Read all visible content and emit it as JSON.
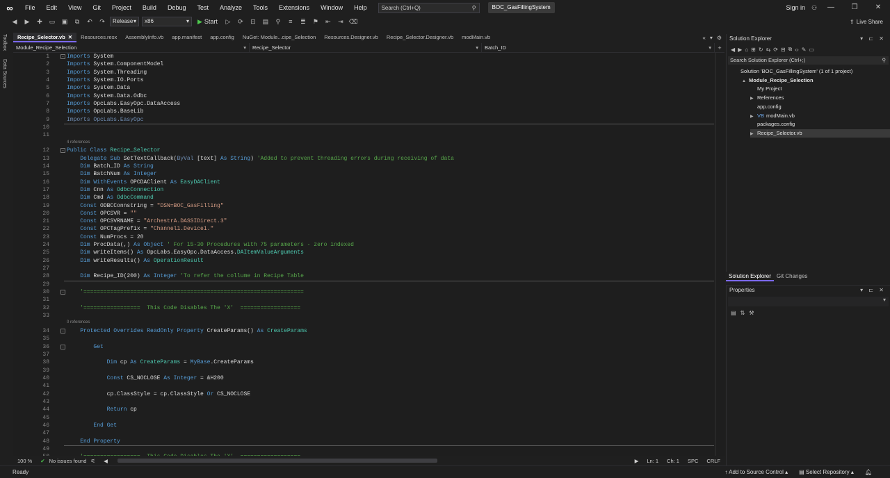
{
  "menubar": {
    "items": [
      "File",
      "Edit",
      "View",
      "Git",
      "Project",
      "Build",
      "Debug",
      "Test",
      "Analyze",
      "Tools",
      "Extensions",
      "Window",
      "Help"
    ],
    "search_placeholder": "Search (Ctrl+Q)",
    "solution_title": "BOC_GasFillingSystem",
    "signin": "Sign in",
    "window_controls": [
      "—",
      "❐",
      "✕"
    ]
  },
  "toolbar": {
    "config": "Release",
    "platform": "x86",
    "start_label": "Start",
    "live_share": "Live Share"
  },
  "left_rail": [
    "Toolbox",
    "Data Sources"
  ],
  "tabs": [
    {
      "label": "Recipe_Selector.vb",
      "active": true
    },
    {
      "label": "Resources.resx"
    },
    {
      "label": "AssemblyInfo.vb"
    },
    {
      "label": "app.manifest"
    },
    {
      "label": "app.config"
    },
    {
      "label": "NuGet: Module...cipe_Selection"
    },
    {
      "label": "Resources.Designer.vb"
    },
    {
      "label": "Recipe_Selector.Designer.vb"
    },
    {
      "label": "modMain.vb"
    }
  ],
  "navbar": {
    "project": "Module_Recipe_Selection",
    "class": "Recipe_Selector",
    "member": "Batch_ID"
  },
  "code": [
    {
      "n": "1",
      "t": [
        [
          "kw",
          "Imports"
        ],
        [
          "id",
          " System"
        ]
      ],
      "fold": "-"
    },
    {
      "n": "2",
      "t": [
        [
          "kw",
          "Imports"
        ],
        [
          "id",
          " System.ComponentModel"
        ]
      ]
    },
    {
      "n": "3",
      "t": [
        [
          "kw",
          "Imports"
        ],
        [
          "id",
          " System.Threading"
        ]
      ]
    },
    {
      "n": "4",
      "t": [
        [
          "kw",
          "Imports"
        ],
        [
          "id",
          " System.IO.Ports"
        ]
      ]
    },
    {
      "n": "5",
      "t": [
        [
          "kw",
          "Imports"
        ],
        [
          "id",
          " System.Data"
        ]
      ]
    },
    {
      "n": "6",
      "t": [
        [
          "kw",
          "Imports"
        ],
        [
          "id",
          " System.Data.Odbc"
        ]
      ]
    },
    {
      "n": "7",
      "t": [
        [
          "kw",
          "Imports"
        ],
        [
          "id",
          " OpcLabs.EasyOpc.DataAccess"
        ]
      ]
    },
    {
      "n": "8",
      "t": [
        [
          "kw",
          "Imports"
        ],
        [
          "id",
          " OpcLabs.BaseLib"
        ]
      ]
    },
    {
      "n": "9",
      "t": [
        [
          "fade",
          "Imports OpcLabs.EasyOpc"
        ]
      ]
    },
    {
      "n": "10",
      "t": []
    },
    {
      "n": "11",
      "t": []
    },
    {
      "n": "12",
      "t": [
        [
          "kw",
          "Public Class "
        ],
        [
          "ty",
          "Recipe_Selector"
        ]
      ],
      "fold": "-",
      "refs": "4 references"
    },
    {
      "n": "13",
      "t": [
        [
          "id",
          "    "
        ],
        [
          "kw",
          "Delegate Sub "
        ],
        [
          "id",
          "SetTextCallback("
        ],
        [
          "fade",
          "ByVal"
        ],
        [
          "id",
          " [text] "
        ],
        [
          "kw",
          "As String"
        ],
        [
          "id",
          ") "
        ],
        [
          "cm",
          "'Added to prevent threading errors during receiving of data"
        ]
      ]
    },
    {
      "n": "14",
      "t": [
        [
          "id",
          "    "
        ],
        [
          "kw",
          "Dim "
        ],
        [
          "id",
          "Batch_ID "
        ],
        [
          "kw",
          "As String"
        ]
      ]
    },
    {
      "n": "15",
      "t": [
        [
          "id",
          "    "
        ],
        [
          "kw",
          "Dim "
        ],
        [
          "id",
          "BatchNum "
        ],
        [
          "kw",
          "As Integer"
        ]
      ]
    },
    {
      "n": "16",
      "t": [
        [
          "id",
          "    "
        ],
        [
          "kw",
          "Dim WithEvents "
        ],
        [
          "id",
          "OPCDAClient "
        ],
        [
          "kw",
          "As "
        ],
        [
          "ty",
          "EasyDAClient"
        ]
      ]
    },
    {
      "n": "17",
      "t": [
        [
          "id",
          "    "
        ],
        [
          "kw",
          "Dim "
        ],
        [
          "id",
          "Cnn "
        ],
        [
          "kw",
          "As "
        ],
        [
          "ty",
          "OdbcConnection"
        ]
      ]
    },
    {
      "n": "18",
      "t": [
        [
          "id",
          "    "
        ],
        [
          "kw",
          "Dim "
        ],
        [
          "id",
          "Cmd "
        ],
        [
          "kw",
          "As "
        ],
        [
          "ty",
          "OdbcCommand"
        ]
      ]
    },
    {
      "n": "19",
      "t": [
        [
          "id",
          "    "
        ],
        [
          "kw",
          "Const "
        ],
        [
          "id",
          "ODBCConnstring = "
        ],
        [
          "st",
          "\"DSN=BOC_GasFilling\""
        ]
      ]
    },
    {
      "n": "20",
      "t": [
        [
          "id",
          "    "
        ],
        [
          "kw",
          "Const "
        ],
        [
          "id",
          "OPCSVR = "
        ],
        [
          "st",
          "\"\""
        ]
      ]
    },
    {
      "n": "21",
      "t": [
        [
          "id",
          "    "
        ],
        [
          "kw",
          "Const "
        ],
        [
          "id",
          "OPCSVRNAME = "
        ],
        [
          "st",
          "\"ArchestrA.DASSIDirect.3\""
        ]
      ]
    },
    {
      "n": "22",
      "t": [
        [
          "id",
          "    "
        ],
        [
          "kw",
          "Const "
        ],
        [
          "id",
          "OPCTagPrefix = "
        ],
        [
          "st",
          "\"Channel1.Device1.\""
        ]
      ]
    },
    {
      "n": "23",
      "t": [
        [
          "id",
          "    "
        ],
        [
          "kw",
          "Const "
        ],
        [
          "id",
          "NumProcs = 20"
        ]
      ]
    },
    {
      "n": "24",
      "t": [
        [
          "id",
          "    "
        ],
        [
          "kw",
          "Dim "
        ],
        [
          "id",
          "ProcData(,) "
        ],
        [
          "kw",
          "As Object "
        ],
        [
          "cm",
          "' For 15-30 Procedures with 75 parameters - zero indexed"
        ]
      ]
    },
    {
      "n": "25",
      "t": [
        [
          "id",
          "    "
        ],
        [
          "kw",
          "Dim "
        ],
        [
          "id",
          "writeItems() "
        ],
        [
          "kw",
          "As "
        ],
        [
          "id",
          "OpcLabs.EasyOpc.DataAccess."
        ],
        [
          "ty",
          "DAItemValueArguments"
        ]
      ]
    },
    {
      "n": "26",
      "t": [
        [
          "id",
          "    "
        ],
        [
          "kw",
          "Dim "
        ],
        [
          "id",
          "writeResults() "
        ],
        [
          "kw",
          "As "
        ],
        [
          "ty",
          "OperationResult"
        ]
      ]
    },
    {
      "n": "27",
      "t": []
    },
    {
      "n": "28",
      "t": [
        [
          "id",
          "    "
        ],
        [
          "kw",
          "Dim "
        ],
        [
          "id",
          "Recipe_ID(200) "
        ],
        [
          "kw",
          "As Integer "
        ],
        [
          "cm",
          "'To refer the collume in Recipe Table"
        ]
      ]
    },
    {
      "n": "29",
      "t": []
    },
    {
      "n": "30",
      "t": [
        [
          "id",
          "    "
        ],
        [
          "cm",
          "'=================================================================="
        ]
      ],
      "fold": "-"
    },
    {
      "n": "31",
      "t": []
    },
    {
      "n": "32",
      "t": [
        [
          "id",
          "    "
        ],
        [
          "cm",
          "'=================  This Code Disables The 'X'  =================="
        ]
      ]
    },
    {
      "n": "33",
      "t": []
    },
    {
      "n": "34",
      "t": [
        [
          "id",
          "    "
        ],
        [
          "kw",
          "Protected Overrides ReadOnly Property "
        ],
        [
          "id",
          "CreateParams() "
        ],
        [
          "kw",
          "As "
        ],
        [
          "ty",
          "CreateParams"
        ]
      ],
      "fold": "-",
      "refs": "0 references"
    },
    {
      "n": "35",
      "t": []
    },
    {
      "n": "36",
      "t": [
        [
          "id",
          "        "
        ],
        [
          "kw",
          "Get"
        ]
      ],
      "fold": "-"
    },
    {
      "n": "37",
      "t": []
    },
    {
      "n": "38",
      "t": [
        [
          "id",
          "            "
        ],
        [
          "kw",
          "Dim "
        ],
        [
          "id",
          "cp "
        ],
        [
          "kw",
          "As "
        ],
        [
          "ty",
          "CreateParams"
        ],
        [
          "id",
          " = "
        ],
        [
          "kw",
          "MyBase"
        ],
        [
          "id",
          ".CreateParams"
        ]
      ]
    },
    {
      "n": "39",
      "t": []
    },
    {
      "n": "40",
      "t": [
        [
          "id",
          "            "
        ],
        [
          "kw",
          "Const "
        ],
        [
          "id",
          "CS_NOCLOSE "
        ],
        [
          "kw",
          "As Integer"
        ],
        [
          "id",
          " = &H200"
        ]
      ]
    },
    {
      "n": "41",
      "t": []
    },
    {
      "n": "42",
      "t": [
        [
          "id",
          "            cp.ClassStyle = cp.ClassStyle "
        ],
        [
          "kw",
          "Or "
        ],
        [
          "id",
          "CS_NOCLOSE"
        ]
      ]
    },
    {
      "n": "43",
      "t": []
    },
    {
      "n": "44",
      "t": [
        [
          "id",
          "            "
        ],
        [
          "kw",
          "Return "
        ],
        [
          "id",
          "cp"
        ]
      ]
    },
    {
      "n": "45",
      "t": []
    },
    {
      "n": "46",
      "t": [
        [
          "id",
          "        "
        ],
        [
          "kw",
          "End Get"
        ]
      ]
    },
    {
      "n": "47",
      "t": []
    },
    {
      "n": "48",
      "t": [
        [
          "id",
          "    "
        ],
        [
          "kw",
          "End Property"
        ]
      ]
    },
    {
      "n": "49",
      "t": []
    },
    {
      "n": "50",
      "t": [
        [
          "id",
          "    "
        ],
        [
          "cm",
          "'=================  This Code Disables The 'X'  =================="
        ]
      ]
    }
  ],
  "editor_status": {
    "zoom": "100 %",
    "issues": "No issues found",
    "ln": "Ln: 1",
    "ch": "Ch: 1",
    "spc": "SPC",
    "crlf": "CRLF"
  },
  "solution_explorer": {
    "title": "Solution Explorer",
    "search_placeholder": "Search Solution Explorer (Ctrl+;)",
    "items": [
      {
        "label": "Solution 'BOC_GasFillingSystem' (1 of 1 project)",
        "indent": 0
      },
      {
        "label": "Module_Recipe_Selection",
        "indent": 1,
        "bold": true,
        "arrow": "▲"
      },
      {
        "label": "My Project",
        "indent": 2
      },
      {
        "label": "References",
        "indent": 2,
        "arrow": "▶"
      },
      {
        "label": "app.config",
        "indent": 2
      },
      {
        "label": "modMain.vb",
        "indent": 2,
        "arrow": "▶",
        "prefix": "VB"
      },
      {
        "label": "packages.config",
        "indent": 2
      },
      {
        "label": "Recipe_Selector.vb",
        "indent": 2,
        "arrow": "▶",
        "selected": true
      }
    ]
  },
  "panel_tabs": [
    "Solution Explorer",
    "Git Changes"
  ],
  "properties": {
    "title": "Properties"
  },
  "statusbar": {
    "ready": "Ready",
    "source_control": "Add to Source Control",
    "repository": "Select Repository"
  }
}
